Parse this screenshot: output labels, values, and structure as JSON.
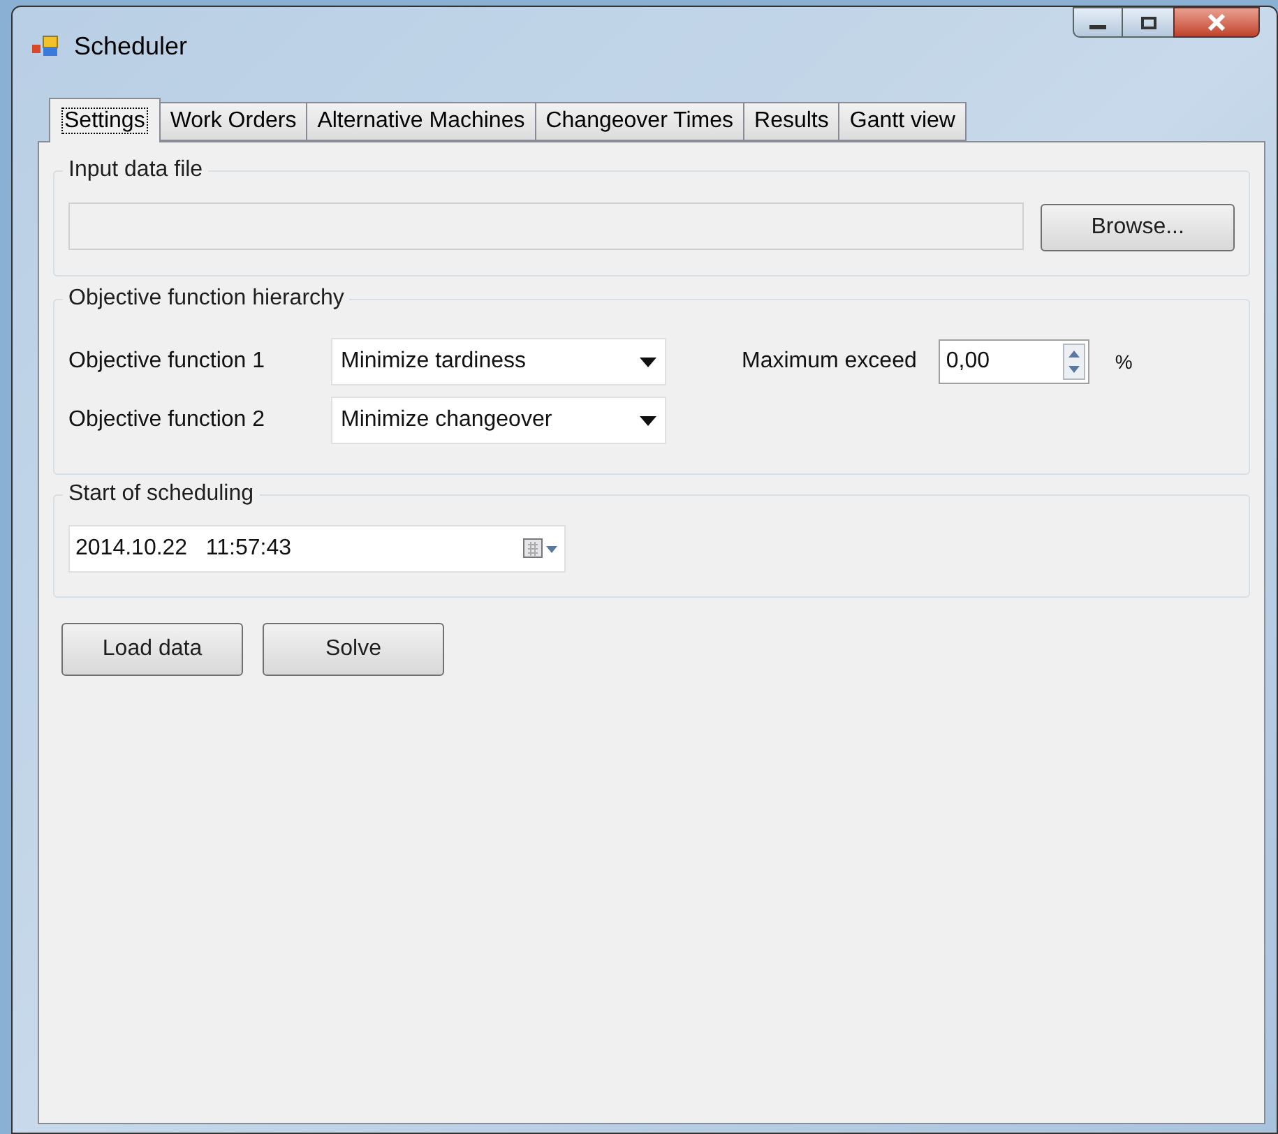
{
  "window": {
    "title": "Scheduler"
  },
  "tabs": [
    {
      "label": "Settings",
      "selected": true
    },
    {
      "label": "Work Orders",
      "selected": false
    },
    {
      "label": "Alternative Machines",
      "selected": false
    },
    {
      "label": "Changeover Times",
      "selected": false
    },
    {
      "label": "Results",
      "selected": false
    },
    {
      "label": "Gantt view",
      "selected": false
    }
  ],
  "input_data_file": {
    "title": "Input data file",
    "button": "Browse..."
  },
  "objective_hierarchy": {
    "title": "Objective function hierarchy",
    "rows": [
      {
        "label": "Objective function 1",
        "value": "Minimize tardiness"
      },
      {
        "label": "Objective function 2",
        "value": "Minimize changeover"
      }
    ],
    "maximum_exceed": {
      "label": "Maximum exceed",
      "value": "0,00",
      "unit": "%"
    }
  },
  "start_of_scheduling": {
    "title": "Start of scheduling",
    "date": "2014.10.22",
    "time": "11:57:43"
  },
  "buttons": [
    "Load data",
    "Solve"
  ]
}
